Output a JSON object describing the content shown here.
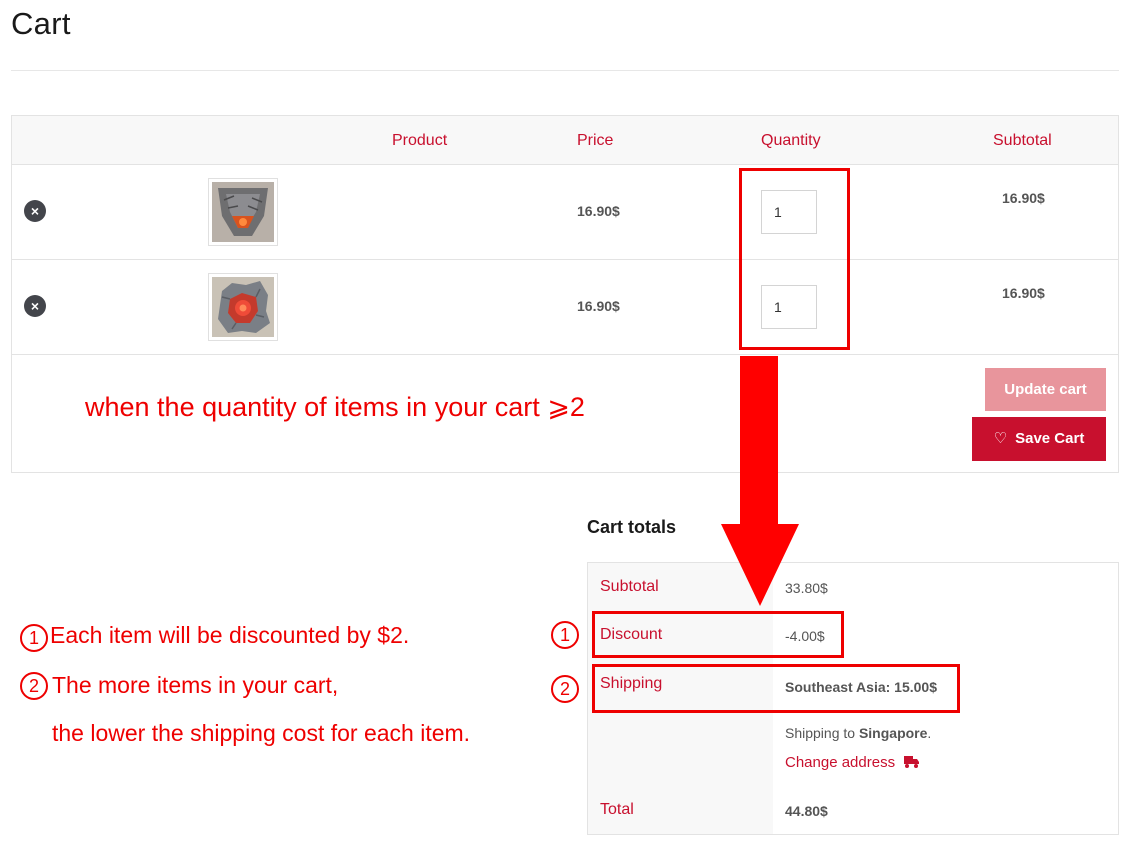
{
  "page": {
    "title": "Cart"
  },
  "table": {
    "headers": {
      "product": "Product",
      "price": "Price",
      "quantity": "Quantity",
      "subtotal": "Subtotal"
    },
    "rows": [
      {
        "price": "16.90$",
        "quantity": "1",
        "subtotal": "16.90$",
        "remove_icon": "×"
      },
      {
        "price": "16.90$",
        "quantity": "1",
        "subtotal": "16.90$",
        "remove_icon": "×"
      }
    ],
    "update_cart_label": "Update cart",
    "save_cart_label": "Save Cart",
    "save_cart_icon": "♡"
  },
  "totals": {
    "heading": "Cart totals",
    "subtotal_label": "Subtotal",
    "subtotal_value": "33.80$",
    "discount_label": "Discount",
    "discount_value": "-4.00$",
    "shipping_label": "Shipping",
    "shipping_value": "Southeast Asia: 15.00$",
    "shipping_to_prefix": "Shipping to",
    "shipping_to_country": "Singapore",
    "shipping_to_suffix": ".",
    "change_address": "Change address",
    "total_label": "Total",
    "total_value": "44.80$"
  },
  "annotations": {
    "main": "when the quantity of items in your cart ⩾2",
    "note1_marker": "1",
    "note1_text": "Each item will be discounted by $2.",
    "note2_marker": "2",
    "note2_line1": "The more items in your cart,",
    "note2_line2": "the lower the shipping cost for each item.",
    "discount_marker": "1",
    "shipping_marker": "2"
  },
  "colors": {
    "accent": "#c8102e",
    "accent_light": "#e8959c",
    "annotation_red": "#ee0000",
    "text": "#43454b"
  },
  "icons": {
    "remove": "remove-circle-icon",
    "save": "heart-icon",
    "change_address": "truck-icon"
  }
}
